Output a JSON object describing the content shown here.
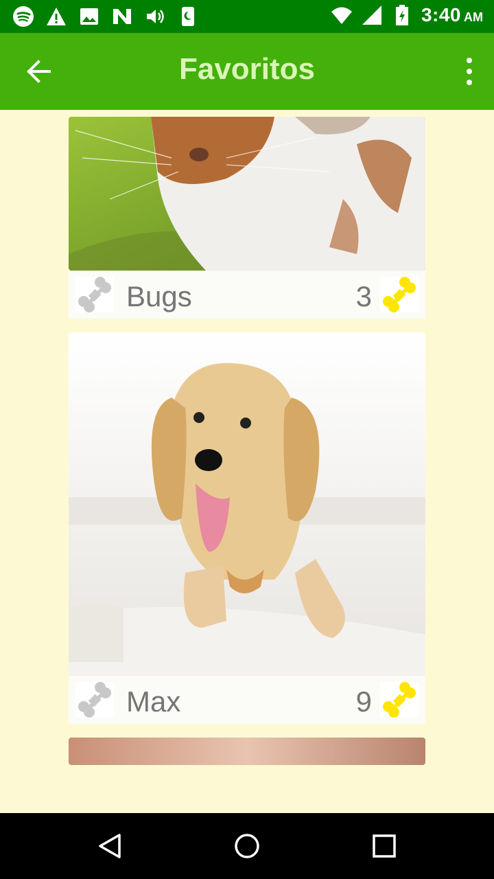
{
  "status_bar": {
    "time": "3:40",
    "ampm": "AM",
    "left_icons": [
      "spotify-icon",
      "warning-icon",
      "image-icon",
      "n-app-icon",
      "volume-icon",
      "moon-phone-icon"
    ],
    "right_icons": [
      "wifi-icon",
      "signal-icon",
      "battery-icon"
    ]
  },
  "toolbar": {
    "title": "Favoritos",
    "back_icon": "arrow-left-icon",
    "menu_icon": "more-vert-icon",
    "color": "#44b00b"
  },
  "favorites": [
    {
      "name": "Bugs",
      "count": "3",
      "photo": "rabbit"
    },
    {
      "name": "Max",
      "count": "9",
      "photo": "puppy"
    },
    {
      "name": "",
      "count": "",
      "photo": "partial"
    }
  ],
  "colors": {
    "background": "#fdfad3",
    "status_bar": "#008000",
    "bone_active": "#ffe500",
    "bone_inactive": "#c8c8c8"
  },
  "nav_bar": {
    "buttons": [
      "back-triangle-icon",
      "home-circle-icon",
      "recents-square-icon"
    ]
  }
}
